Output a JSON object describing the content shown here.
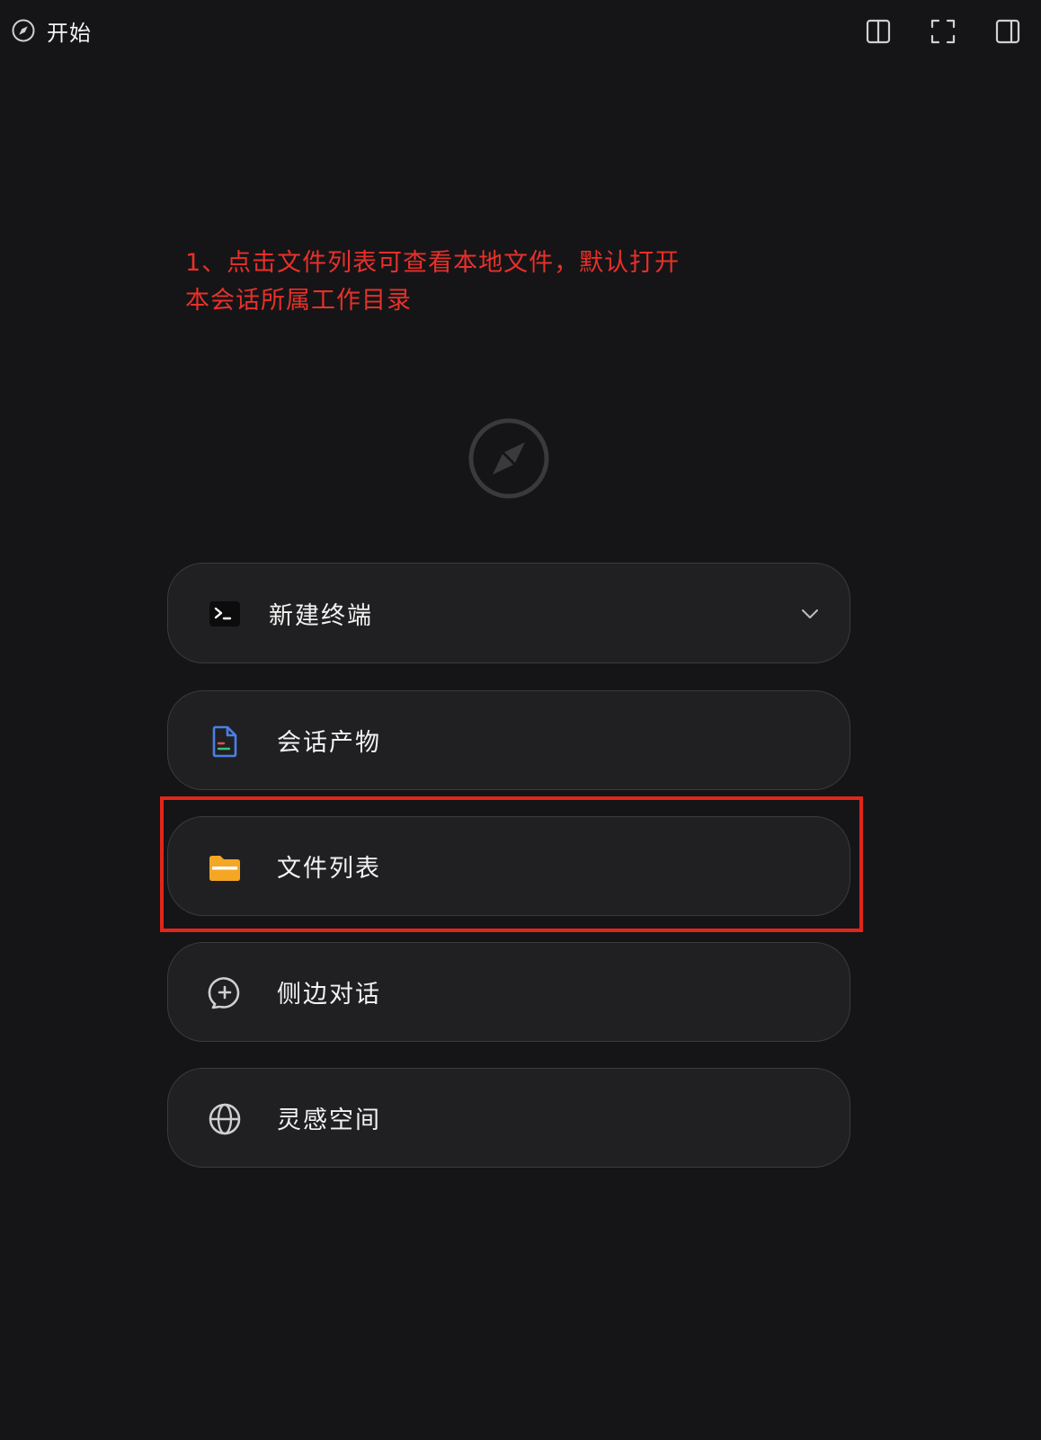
{
  "header": {
    "tab_title": "开始",
    "tab_icon": "compass-icon",
    "actions": [
      {
        "icon": "split-view-icon"
      },
      {
        "icon": "fullscreen-icon"
      },
      {
        "icon": "right-sidebar-icon"
      }
    ]
  },
  "annotation": {
    "line1": "1、点击文件列表可查看本地文件，默认打开",
    "line2": "本会话所属工作目录"
  },
  "hero_icon": "compass-icon",
  "menu": {
    "items": [
      {
        "label": "新建终端",
        "icon": "terminal-icon",
        "has_dropdown": true
      },
      {
        "label": "会话产物",
        "icon": "document-icon"
      },
      {
        "label": "文件列表",
        "icon": "folder-icon",
        "highlighted": true
      },
      {
        "label": "侧边对话",
        "icon": "chat-add-icon"
      },
      {
        "label": "灵感空间",
        "icon": "globe-icon"
      }
    ]
  },
  "colors": {
    "background": "#151517",
    "card": "#202022",
    "annotation": "#e8302a",
    "highlight_border": "#e1251b",
    "folder": "#f5a623",
    "document": "#4a7fe8"
  }
}
